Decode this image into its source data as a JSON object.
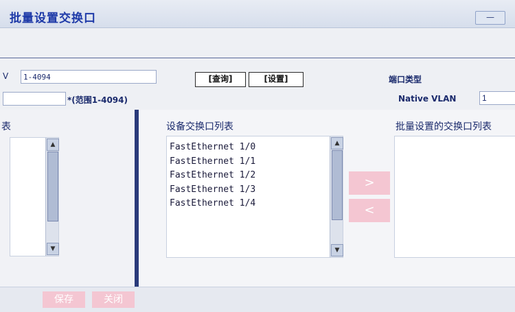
{
  "window": {
    "title": "批量设置交换口",
    "title_button": "—"
  },
  "form": {
    "vlan_label": "V",
    "vlan_value": "1-4094",
    "query_button": "[查询]",
    "config_button": "[设置]",
    "right_label": "端口类型",
    "range_text": "*(范围1-4094)",
    "native_label": "Native VLAN",
    "native_value": "1"
  },
  "left_panel": {
    "header": "表"
  },
  "device_list": {
    "header": "设备交换口列表",
    "items": [
      "FastEthernet 1/0",
      "FastEthernet 1/1",
      "FastEthernet 1/2",
      "FastEthernet 1/3",
      "FastEthernet 1/4"
    ]
  },
  "batch_list": {
    "header": "批量设置的交换口列表"
  },
  "transfer": {
    "right": ">",
    "left": "<"
  },
  "footer": {
    "save": "保存",
    "close": "关闭"
  }
}
